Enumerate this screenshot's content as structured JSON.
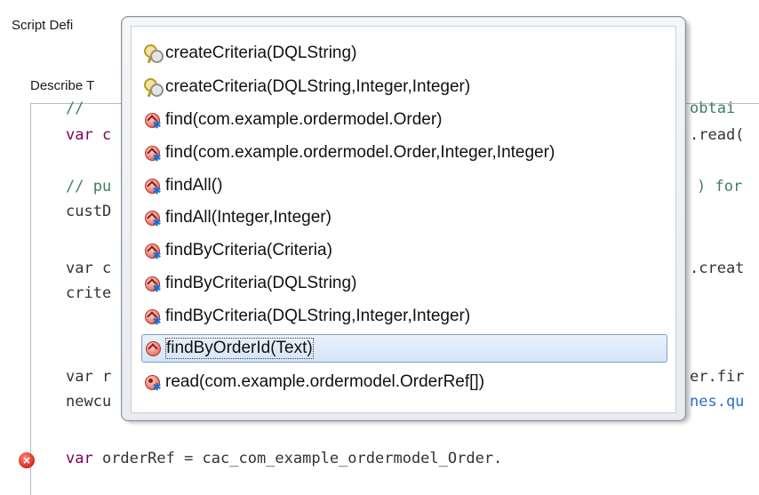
{
  "panel": {
    "title": "Script Defi",
    "subsection": "Describe T"
  },
  "editor": {
    "lines": [
      {
        "left": "// ",
        "right": "obtai"
      },
      {
        "left": "var c",
        "right": ".read("
      },
      {
        "left": "// pu",
        "right": ") for"
      },
      {
        "left": "custD",
        "right": ""
      },
      {
        "left": "var c",
        "right": ".creat"
      },
      {
        "left": "crite",
        "right": ""
      },
      {
        "left": "var r",
        "right": "er.fir"
      },
      {
        "left": "newcu",
        "right": "nes.qu"
      }
    ],
    "error_line": {
      "keyword": "var",
      "text": " orderRef = cac_com_example_ordermodel_Order."
    },
    "error_icon": "error-icon"
  },
  "completion_popup": {
    "items": [
      {
        "label": "createCriteria(DQLString)",
        "icon": "template-keys-icon"
      },
      {
        "label": "createCriteria(DQLString,Integer,Integer)",
        "icon": "template-keys-icon"
      },
      {
        "label": "find(com.example.ordermodel.Order)",
        "icon": "static-method-icon"
      },
      {
        "label": "find(com.example.ordermodel.Order,Integer,Integer)",
        "icon": "static-method-icon"
      },
      {
        "label": "findAll()",
        "icon": "static-method-icon"
      },
      {
        "label": "findAll(Integer,Integer)",
        "icon": "static-method-icon"
      },
      {
        "label": "findByCriteria(Criteria)",
        "icon": "static-method-icon"
      },
      {
        "label": "findByCriteria(DQLString)",
        "icon": "static-method-icon"
      },
      {
        "label": "findByCriteria(DQLString,Integer,Integer)",
        "icon": "static-method-icon"
      },
      {
        "label": "findByOrderId(Text)",
        "icon": "method-icon",
        "selected": true
      },
      {
        "label": "read(com.example.ordermodel.OrderRef[])",
        "icon": "static-private-method-icon"
      }
    ]
  },
  "colors": {
    "comment": "#3f7f5f",
    "keyword": "#7f0055",
    "selection": "#d4e4f7",
    "error": "#d2291a"
  }
}
